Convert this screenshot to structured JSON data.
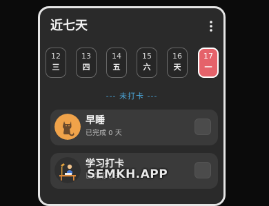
{
  "header": {
    "title": "近七天",
    "more_icon": "more-vertical-icon"
  },
  "days": [
    {
      "num": "12",
      "weekday": "三",
      "active": false
    },
    {
      "num": "13",
      "weekday": "四",
      "active": false
    },
    {
      "num": "14",
      "weekday": "五",
      "active": false
    },
    {
      "num": "15",
      "weekday": "六",
      "active": false
    },
    {
      "num": "16",
      "weekday": "天",
      "active": false
    },
    {
      "num": "17",
      "weekday": "一",
      "active": true
    }
  ],
  "section": {
    "label": "--- 未打卡 ---"
  },
  "habits": [
    {
      "name": "早睡",
      "status": "已完成 0 天",
      "icon": "cat-icon",
      "checked": false
    },
    {
      "name": "学习打卡",
      "status": "已完成 0 天",
      "icon": "study-desk-icon",
      "checked": false
    }
  ],
  "watermark": {
    "text": "SEMKH.APP"
  },
  "colors": {
    "accent": "#e5626a",
    "section_label": "#4ba6d9",
    "card_bg": "#2a2a2a",
    "habit_bg": "#3a3a3a",
    "cat_avatar_bg": "#f0a34a"
  }
}
